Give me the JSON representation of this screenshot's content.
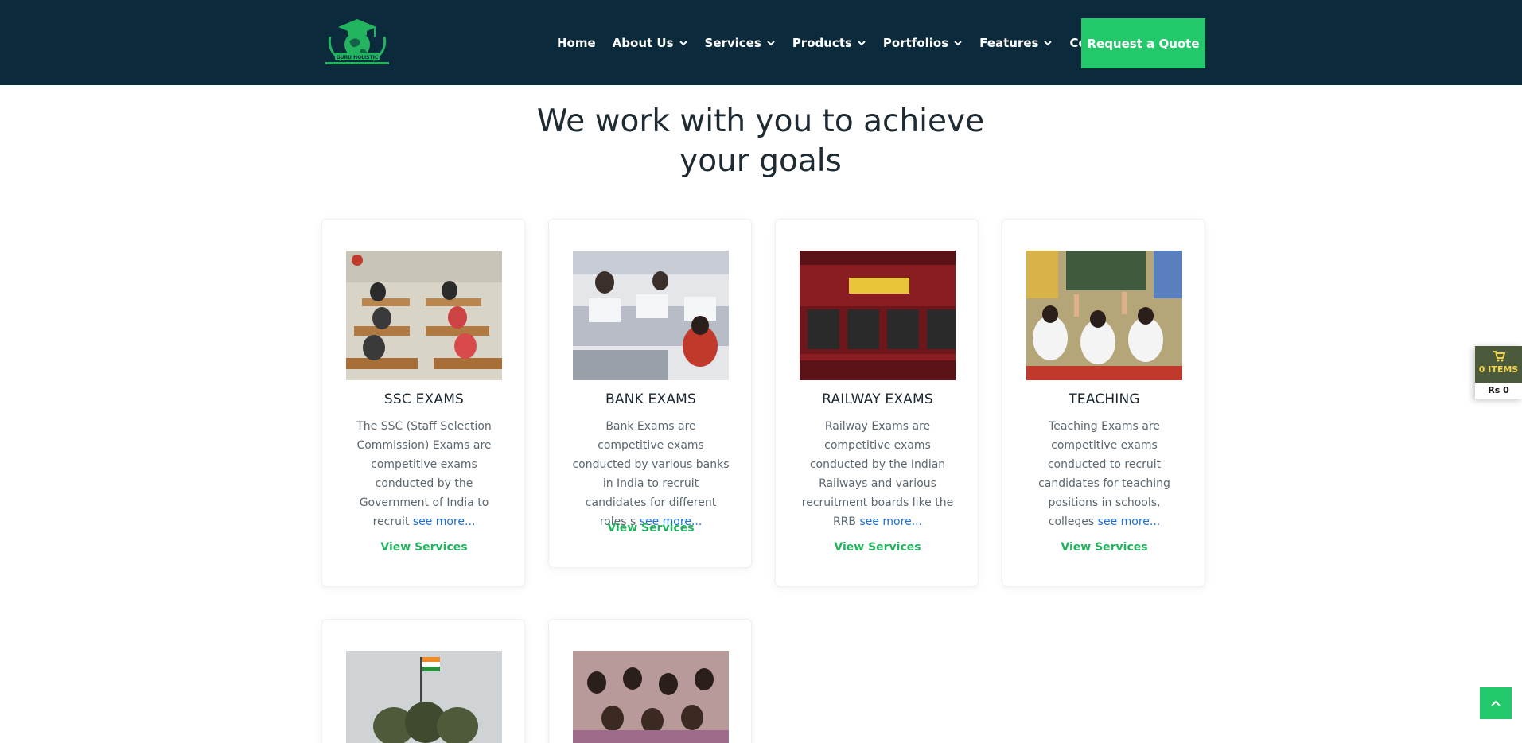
{
  "header": {
    "logo_text": "GURU HOLISTIC",
    "nav": [
      {
        "label": "Home",
        "dropdown": false
      },
      {
        "label": "About Us",
        "dropdown": true
      },
      {
        "label": "Services",
        "dropdown": true
      },
      {
        "label": "Products",
        "dropdown": true
      },
      {
        "label": "Portfolios",
        "dropdown": true
      },
      {
        "label": "Features",
        "dropdown": true
      },
      {
        "label": "Contact",
        "dropdown": false
      }
    ],
    "cta_label": "Request a Quote"
  },
  "main": {
    "heading_line1": "We work with you to achieve",
    "heading_line2": "your goals",
    "cards": [
      {
        "title": "SSC EXAMS",
        "desc": "The SSC (Staff Selection Commission) Exams are competitive exams conducted by the Government of India to recruit",
        "see_more": "see more...",
        "view": "View Services"
      },
      {
        "title": "BANK EXAMS",
        "desc": "Bank Exams are competitive exams conducted by various banks in India to recruit candidates for different roles s",
        "see_more": "see more...",
        "view": "View Services"
      },
      {
        "title": "RAILWAY EXAMS",
        "desc": "Railway Exams are competitive exams conducted by the Indian Railways and various recruitment boards like the RRB",
        "see_more": "see more...",
        "view": "View Services"
      },
      {
        "title": "TEACHING",
        "desc": "Teaching Exams are competitive exams conducted to recruit candidates for teaching positions in schools, colleges",
        "see_more": "see more...",
        "view": "View Services"
      }
    ]
  },
  "cart": {
    "items_label": "0 ITEMS",
    "total_label": "Rs 0"
  },
  "colors": {
    "header_bg": "#0b2a3b",
    "accent_green": "#22c86a",
    "link_blue": "#1a6fd8"
  }
}
